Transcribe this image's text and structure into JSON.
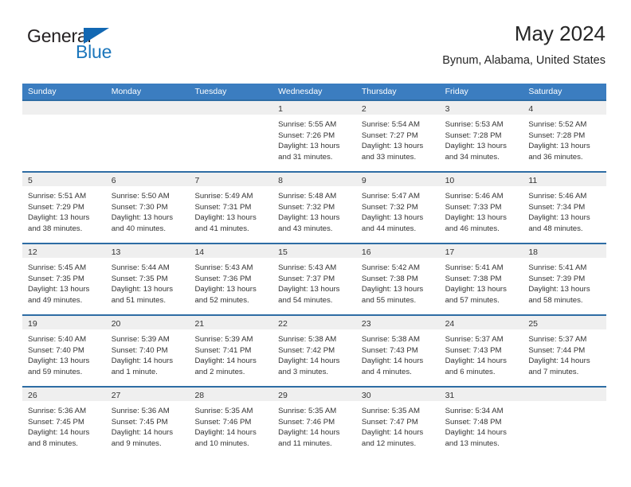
{
  "brand": {
    "name_part1": "General",
    "name_part2": "Blue"
  },
  "header": {
    "month_title": "May 2024",
    "location": "Bynum, Alabama, United States"
  },
  "colors": {
    "header_bar": "#3b7dc0",
    "row_border": "#2e6da4",
    "day_band": "#efefef",
    "brand_blue": "#1b76bc",
    "text": "#333333"
  },
  "calendar": {
    "weekdays": [
      "Sunday",
      "Monday",
      "Tuesday",
      "Wednesday",
      "Thursday",
      "Friday",
      "Saturday"
    ],
    "weeks": [
      [
        {
          "day": "",
          "empty": true
        },
        {
          "day": "",
          "empty": true
        },
        {
          "day": "",
          "empty": true
        },
        {
          "day": "1",
          "sunrise": "Sunrise: 5:55 AM",
          "sunset": "Sunset: 7:26 PM",
          "daylight_1": "Daylight: 13 hours",
          "daylight_2": "and 31 minutes."
        },
        {
          "day": "2",
          "sunrise": "Sunrise: 5:54 AM",
          "sunset": "Sunset: 7:27 PM",
          "daylight_1": "Daylight: 13 hours",
          "daylight_2": "and 33 minutes."
        },
        {
          "day": "3",
          "sunrise": "Sunrise: 5:53 AM",
          "sunset": "Sunset: 7:28 PM",
          "daylight_1": "Daylight: 13 hours",
          "daylight_2": "and 34 minutes."
        },
        {
          "day": "4",
          "sunrise": "Sunrise: 5:52 AM",
          "sunset": "Sunset: 7:28 PM",
          "daylight_1": "Daylight: 13 hours",
          "daylight_2": "and 36 minutes."
        }
      ],
      [
        {
          "day": "5",
          "sunrise": "Sunrise: 5:51 AM",
          "sunset": "Sunset: 7:29 PM",
          "daylight_1": "Daylight: 13 hours",
          "daylight_2": "and 38 minutes."
        },
        {
          "day": "6",
          "sunrise": "Sunrise: 5:50 AM",
          "sunset": "Sunset: 7:30 PM",
          "daylight_1": "Daylight: 13 hours",
          "daylight_2": "and 40 minutes."
        },
        {
          "day": "7",
          "sunrise": "Sunrise: 5:49 AM",
          "sunset": "Sunset: 7:31 PM",
          "daylight_1": "Daylight: 13 hours",
          "daylight_2": "and 41 minutes."
        },
        {
          "day": "8",
          "sunrise": "Sunrise: 5:48 AM",
          "sunset": "Sunset: 7:32 PM",
          "daylight_1": "Daylight: 13 hours",
          "daylight_2": "and 43 minutes."
        },
        {
          "day": "9",
          "sunrise": "Sunrise: 5:47 AM",
          "sunset": "Sunset: 7:32 PM",
          "daylight_1": "Daylight: 13 hours",
          "daylight_2": "and 44 minutes."
        },
        {
          "day": "10",
          "sunrise": "Sunrise: 5:46 AM",
          "sunset": "Sunset: 7:33 PM",
          "daylight_1": "Daylight: 13 hours",
          "daylight_2": "and 46 minutes."
        },
        {
          "day": "11",
          "sunrise": "Sunrise: 5:46 AM",
          "sunset": "Sunset: 7:34 PM",
          "daylight_1": "Daylight: 13 hours",
          "daylight_2": "and 48 minutes."
        }
      ],
      [
        {
          "day": "12",
          "sunrise": "Sunrise: 5:45 AM",
          "sunset": "Sunset: 7:35 PM",
          "daylight_1": "Daylight: 13 hours",
          "daylight_2": "and 49 minutes."
        },
        {
          "day": "13",
          "sunrise": "Sunrise: 5:44 AM",
          "sunset": "Sunset: 7:35 PM",
          "daylight_1": "Daylight: 13 hours",
          "daylight_2": "and 51 minutes."
        },
        {
          "day": "14",
          "sunrise": "Sunrise: 5:43 AM",
          "sunset": "Sunset: 7:36 PM",
          "daylight_1": "Daylight: 13 hours",
          "daylight_2": "and 52 minutes."
        },
        {
          "day": "15",
          "sunrise": "Sunrise: 5:43 AM",
          "sunset": "Sunset: 7:37 PM",
          "daylight_1": "Daylight: 13 hours",
          "daylight_2": "and 54 minutes."
        },
        {
          "day": "16",
          "sunrise": "Sunrise: 5:42 AM",
          "sunset": "Sunset: 7:38 PM",
          "daylight_1": "Daylight: 13 hours",
          "daylight_2": "and 55 minutes."
        },
        {
          "day": "17",
          "sunrise": "Sunrise: 5:41 AM",
          "sunset": "Sunset: 7:38 PM",
          "daylight_1": "Daylight: 13 hours",
          "daylight_2": "and 57 minutes."
        },
        {
          "day": "18",
          "sunrise": "Sunrise: 5:41 AM",
          "sunset": "Sunset: 7:39 PM",
          "daylight_1": "Daylight: 13 hours",
          "daylight_2": "and 58 minutes."
        }
      ],
      [
        {
          "day": "19",
          "sunrise": "Sunrise: 5:40 AM",
          "sunset": "Sunset: 7:40 PM",
          "daylight_1": "Daylight: 13 hours",
          "daylight_2": "and 59 minutes."
        },
        {
          "day": "20",
          "sunrise": "Sunrise: 5:39 AM",
          "sunset": "Sunset: 7:40 PM",
          "daylight_1": "Daylight: 14 hours",
          "daylight_2": "and 1 minute."
        },
        {
          "day": "21",
          "sunrise": "Sunrise: 5:39 AM",
          "sunset": "Sunset: 7:41 PM",
          "daylight_1": "Daylight: 14 hours",
          "daylight_2": "and 2 minutes."
        },
        {
          "day": "22",
          "sunrise": "Sunrise: 5:38 AM",
          "sunset": "Sunset: 7:42 PM",
          "daylight_1": "Daylight: 14 hours",
          "daylight_2": "and 3 minutes."
        },
        {
          "day": "23",
          "sunrise": "Sunrise: 5:38 AM",
          "sunset": "Sunset: 7:43 PM",
          "daylight_1": "Daylight: 14 hours",
          "daylight_2": "and 4 minutes."
        },
        {
          "day": "24",
          "sunrise": "Sunrise: 5:37 AM",
          "sunset": "Sunset: 7:43 PM",
          "daylight_1": "Daylight: 14 hours",
          "daylight_2": "and 6 minutes."
        },
        {
          "day": "25",
          "sunrise": "Sunrise: 5:37 AM",
          "sunset": "Sunset: 7:44 PM",
          "daylight_1": "Daylight: 14 hours",
          "daylight_2": "and 7 minutes."
        }
      ],
      [
        {
          "day": "26",
          "sunrise": "Sunrise: 5:36 AM",
          "sunset": "Sunset: 7:45 PM",
          "daylight_1": "Daylight: 14 hours",
          "daylight_2": "and 8 minutes."
        },
        {
          "day": "27",
          "sunrise": "Sunrise: 5:36 AM",
          "sunset": "Sunset: 7:45 PM",
          "daylight_1": "Daylight: 14 hours",
          "daylight_2": "and 9 minutes."
        },
        {
          "day": "28",
          "sunrise": "Sunrise: 5:35 AM",
          "sunset": "Sunset: 7:46 PM",
          "daylight_1": "Daylight: 14 hours",
          "daylight_2": "and 10 minutes."
        },
        {
          "day": "29",
          "sunrise": "Sunrise: 5:35 AM",
          "sunset": "Sunset: 7:46 PM",
          "daylight_1": "Daylight: 14 hours",
          "daylight_2": "and 11 minutes."
        },
        {
          "day": "30",
          "sunrise": "Sunrise: 5:35 AM",
          "sunset": "Sunset: 7:47 PM",
          "daylight_1": "Daylight: 14 hours",
          "daylight_2": "and 12 minutes."
        },
        {
          "day": "31",
          "sunrise": "Sunrise: 5:34 AM",
          "sunset": "Sunset: 7:48 PM",
          "daylight_1": "Daylight: 14 hours",
          "daylight_2": "and 13 minutes."
        },
        {
          "day": "",
          "empty": true
        }
      ]
    ]
  }
}
